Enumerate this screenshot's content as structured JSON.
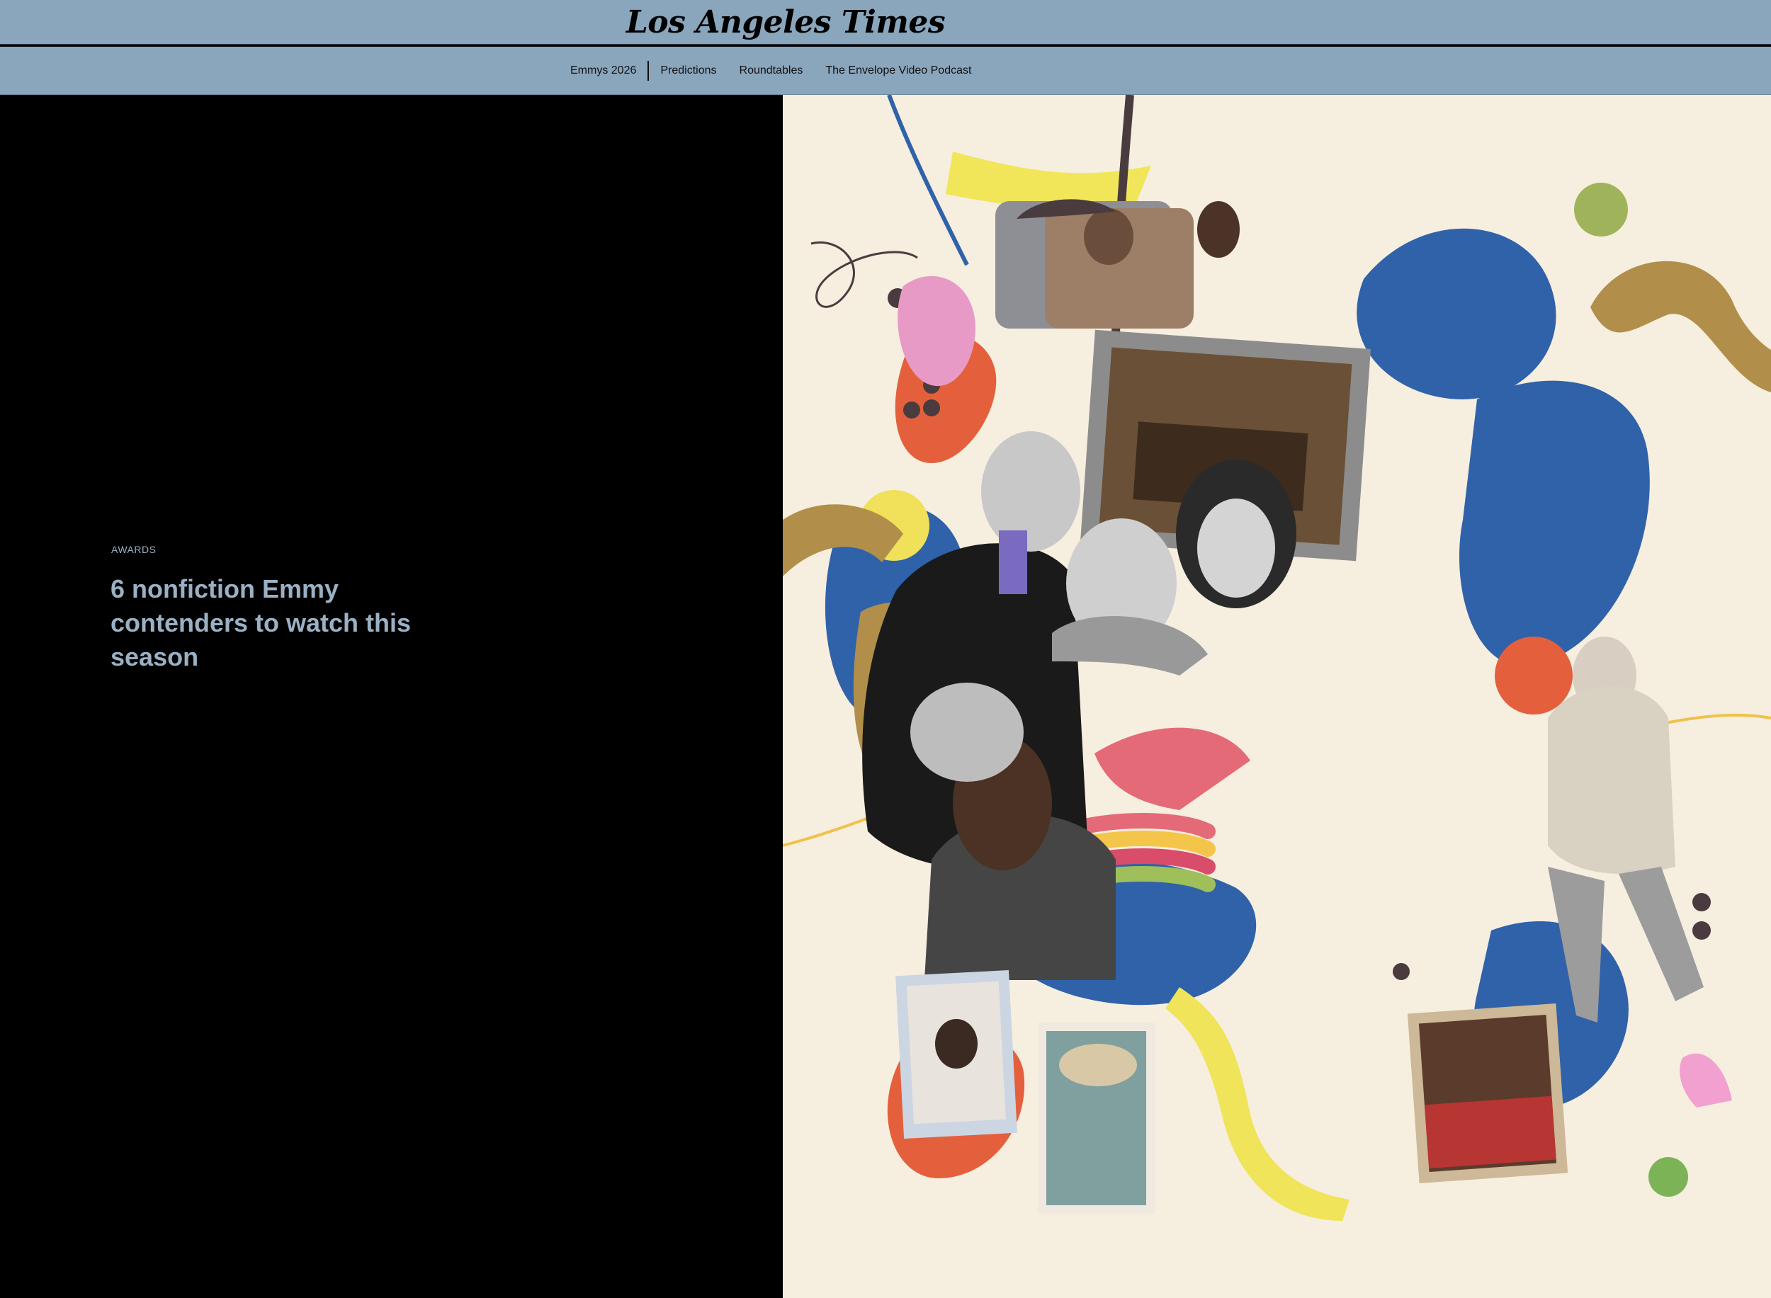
{
  "header": {
    "logo_text": "Los Angeles Times"
  },
  "subnav": {
    "items": [
      {
        "label": "Emmys 2026"
      },
      {
        "label": "Predictions"
      },
      {
        "label": "Roundtables"
      },
      {
        "label": "The Envelope Video Podcast"
      }
    ]
  },
  "article": {
    "kicker": "AWARDS",
    "headline": "6 nonfiction Emmy contenders to watch this season"
  },
  "colors": {
    "header_bg": "#8aa6bd",
    "headline_color": "#9ab0c4",
    "left_bg": "#000000",
    "collage_bg": "#f6eedf"
  }
}
